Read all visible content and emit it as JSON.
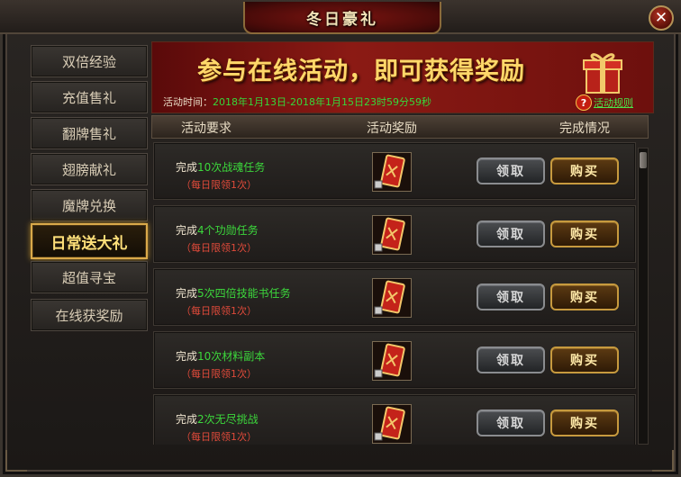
{
  "window": {
    "title": "冬日豪礼",
    "close_label": "✕"
  },
  "sidebar": {
    "items": [
      {
        "label": "双倍经验",
        "active": false
      },
      {
        "label": "充值售礼",
        "active": false
      },
      {
        "label": "翻牌售礼",
        "active": false
      },
      {
        "label": "翅膀献礼",
        "active": false
      },
      {
        "label": "魔牌兑换",
        "active": false
      },
      {
        "label": "日常送大礼",
        "active": true
      },
      {
        "label": "超值寻宝",
        "active": false
      },
      {
        "label": "在线获奖励",
        "active": false
      }
    ]
  },
  "banner": {
    "headline": "参与在线活动，即可获得奖励",
    "time_label": "活动时间：",
    "time_value": "2018年1月13日-2018年1月15日23时59分59秒",
    "rules_label": "活动规则",
    "help_icon": "?"
  },
  "table": {
    "headers": [
      "活动要求",
      "活动奖励",
      "完成情况"
    ],
    "rows": [
      {
        "prefix": "完成",
        "highlight": "10次战魂任务",
        "suffix": "",
        "limit": "（每日限领1次）",
        "reward_icon": "red-card-icon",
        "claim_label": "领取",
        "buy_label": "购买"
      },
      {
        "prefix": "完成",
        "highlight": "4个功勋任务",
        "suffix": "",
        "limit": "（每日限领1次）",
        "reward_icon": "red-card-icon",
        "claim_label": "领取",
        "buy_label": "购买"
      },
      {
        "prefix": "完成",
        "highlight": "5次四倍技能书任务",
        "suffix": "",
        "limit": "（每日限领1次）",
        "reward_icon": "red-card-icon",
        "claim_label": "领取",
        "buy_label": "购买"
      },
      {
        "prefix": "完成",
        "highlight": "10次材料副本",
        "suffix": "",
        "limit": "（每日限领1次）",
        "reward_icon": "red-card-icon",
        "claim_label": "领取",
        "buy_label": "购买"
      },
      {
        "prefix": "完成",
        "highlight": "2次无尽挑战",
        "suffix": "",
        "limit": "（每日限领1次）",
        "reward_icon": "red-card-icon",
        "claim_label": "领取",
        "buy_label": "购买"
      }
    ]
  },
  "colors": {
    "accent_gold": "#d9a94a",
    "highlight_green": "#3cd83c",
    "limit_red": "#e04a3a",
    "banner_red": "#8b1a14"
  }
}
